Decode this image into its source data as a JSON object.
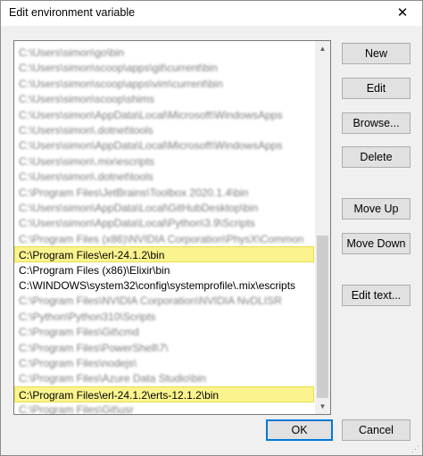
{
  "window": {
    "title": "Edit environment variable",
    "close_glyph": "✕"
  },
  "list": {
    "items": [
      {
        "text": "C:\\Users\\simon\\go\\bin",
        "state": "blurred"
      },
      {
        "text": "C:\\Users\\simon\\scoop\\apps\\git\\current\\bin",
        "state": "blurred"
      },
      {
        "text": "C:\\Users\\simon\\scoop\\apps\\vim\\current\\bin",
        "state": "blurred"
      },
      {
        "text": "C:\\Users\\simon\\scoop\\shims",
        "state": "blurred"
      },
      {
        "text": "C:\\Users\\simon\\AppData\\Local\\Microsoft\\WindowsApps",
        "state": "blurred"
      },
      {
        "text": "C:\\Users\\simon\\.dotnet\\tools",
        "state": "blurred"
      },
      {
        "text": "C:\\Users\\simon\\AppData\\Local\\Microsoft\\WindowsApps",
        "state": "blurred"
      },
      {
        "text": "C:\\Users\\simon\\.mix\\escripts",
        "state": "blurred"
      },
      {
        "text": "C:\\Users\\simon\\.dotnet\\tools",
        "state": "blurred"
      },
      {
        "text": "C:\\Program Files\\JetBrains\\Toolbox 2020.1.4\\bin",
        "state": "blurred"
      },
      {
        "text": "C:\\Users\\simon\\AppData\\Local\\GitHubDesktop\\bin",
        "state": "blurred"
      },
      {
        "text": "C:\\Users\\simon\\AppData\\Local\\Python\\3.9\\Scripts",
        "state": "blurred"
      },
      {
        "text": "C:\\Program Files (x86)\\NVIDIA Corporation\\PhysX\\Common",
        "state": "blurred"
      },
      {
        "text": "C:\\Program Files\\erl-24.1.2\\bin",
        "state": "highlighted"
      },
      {
        "text": "C:\\Program Files (x86)\\Elixir\\bin",
        "state": "normal"
      },
      {
        "text": "C:\\WINDOWS\\system32\\config\\systemprofile\\.mix\\escripts",
        "state": "normal"
      },
      {
        "text": "C:\\Program Files\\NVIDIA Corporation\\NVIDIA NvDLISR",
        "state": "blurred"
      },
      {
        "text": "C:\\Python\\Python310\\Scripts",
        "state": "blurred"
      },
      {
        "text": "C:\\Program Files\\Git\\cmd",
        "state": "blurred"
      },
      {
        "text": "C:\\Program Files\\PowerShell\\7\\",
        "state": "blurred"
      },
      {
        "text": "C:\\Program Files\\nodejs\\",
        "state": "blurred"
      },
      {
        "text": "C:\\Program Files\\Azure Data Studio\\bin",
        "state": "blurred"
      },
      {
        "text": "C:\\Program Files\\erl-24.1.2\\erts-12.1.2\\bin",
        "state": "highlighted"
      },
      {
        "text": "C:\\Program Files\\Git\\usr",
        "state": "blurred"
      }
    ],
    "scroll": {
      "up_glyph": "▲",
      "down_glyph": "▼"
    }
  },
  "buttons": {
    "new": "New",
    "edit": "Edit",
    "browse": "Browse...",
    "delete": "Delete",
    "move_up": "Move Up",
    "move_down": "Move Down",
    "edit_text": "Edit text...",
    "ok": "OK",
    "cancel": "Cancel"
  },
  "colors": {
    "highlight": "#fbf48e",
    "dialog_bg": "#f0f0f0",
    "ok_border": "#0078d7"
  }
}
